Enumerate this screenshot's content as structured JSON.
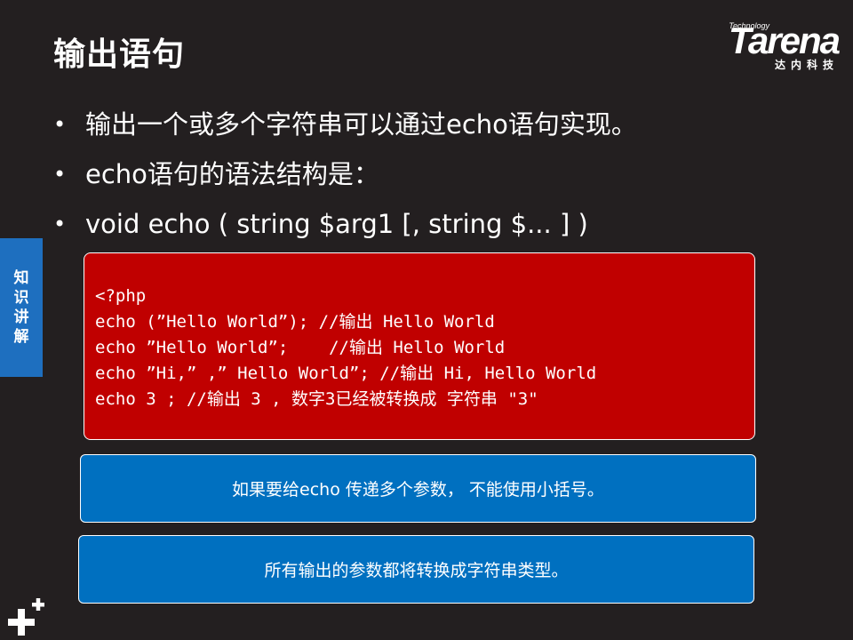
{
  "slide": {
    "title": "输出语句"
  },
  "logo": {
    "small": "Technology",
    "main": "Tarena",
    "sub": "达内科技"
  },
  "bullets": [
    "输出一个或多个字符串可以通过echo语句实现。",
    "echo语句的语法结构是：",
    "void echo ( string $arg1 [, string $... ] )"
  ],
  "side_tab": {
    "label": "知识讲解"
  },
  "code": {
    "lines": [
      "<?php",
      "echo (”Hello World”); //输出 Hello World",
      "echo ”Hello World”;    //输出 Hello World",
      "echo ”Hi,” ,” Hello World”; //输出 Hi, Hello World",
      "echo 3 ; //输出 3 , 数字3已经被转换成 字符串 \"3\""
    ]
  },
  "notes": [
    "如果要给echo 传递多个参数， 不能使用小括号。",
    "所有输出的参数都将转换成字符串类型。"
  ],
  "colors": {
    "background": "#231f20",
    "code_box": "#c00000",
    "note_box": "#0070c0",
    "side_tab": "#1e6fbf"
  },
  "icons": {
    "bottom_left": "plus-plus-icon"
  }
}
